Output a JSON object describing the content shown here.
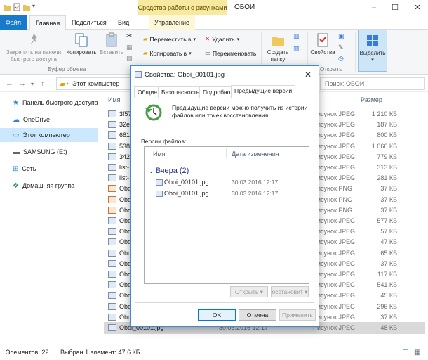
{
  "window": {
    "title": "ОБОИ",
    "context_tab": "Средства работы с рисунками"
  },
  "ribbon_tabs": [
    "Файл",
    "Главная",
    "Поделиться",
    "Вид",
    "Управление"
  ],
  "ribbon": {
    "pin_label": "Закрепить на панели быстрого доступа",
    "copy_label": "Копировать",
    "paste_label": "Вставить",
    "clipboard_group": "Буфер обмена",
    "move_to": "Переместить в",
    "copy_to": "Копировать в",
    "delete": "Удалить",
    "rename": "Переименовать",
    "new_folder": "Создать папку",
    "properties": "Свойства",
    "select": "Выделить",
    "open_group": "Открыть"
  },
  "address": {
    "crumb": "Этот компьютер",
    "search_placeholder": "Поиск: ОБОИ"
  },
  "sidebar": [
    {
      "label": "Панель быстрого доступа",
      "icon": "star-icon"
    },
    {
      "label": "OneDrive",
      "icon": "cloud-icon"
    },
    {
      "label": "Этот компьютер",
      "icon": "computer-icon",
      "selected": true
    },
    {
      "label": "SAMSUNG (E:)",
      "icon": "drive-icon"
    },
    {
      "label": "Сеть",
      "icon": "network-icon"
    },
    {
      "label": "Домашняя группа",
      "icon": "homegroup-icon"
    }
  ],
  "columns": {
    "name": "Имя",
    "size": "Размер"
  },
  "files": [
    {
      "name": "3f57",
      "type": "Рисунок JPEG",
      "size": "1 210 КБ",
      "png": false
    },
    {
      "name": "32ea",
      "type": "Рисунок JPEG",
      "size": "187 КБ",
      "png": false
    },
    {
      "name": "6814",
      "type": "Рисунок JPEG",
      "size": "800 КБ",
      "png": false
    },
    {
      "name": "5384",
      "type": "Рисунок JPEG",
      "size": "1 066 КБ",
      "png": false
    },
    {
      "name": "3429",
      "type": "Рисунок JPEG",
      "size": "779 КБ",
      "png": false
    },
    {
      "name": "list-",
      "type": "Рисунок JPEG",
      "size": "313 КБ",
      "png": false
    },
    {
      "name": "list-",
      "type": "Рисунок JPEG",
      "size": "281 КБ",
      "png": false
    },
    {
      "name": "Oboi",
      "type": "Рисунок PNG",
      "size": "37 КБ",
      "png": true
    },
    {
      "name": "Oboi",
      "type": "Рисунок PNG",
      "size": "37 КБ",
      "png": true
    },
    {
      "name": "Oboi",
      "type": "Рисунок PNG",
      "size": "37 КБ",
      "png": true
    },
    {
      "name": "Oboi",
      "type": "Рисунок JPEG",
      "size": "577 КБ",
      "png": false
    },
    {
      "name": "Oboi",
      "type": "Рисунок JPEG",
      "size": "57 КБ",
      "png": false
    },
    {
      "name": "Oboi",
      "type": "Рисунок JPEG",
      "size": "47 КБ",
      "png": false
    },
    {
      "name": "Oboi",
      "type": "Рисунок JPEG",
      "size": "65 КБ",
      "png": false
    },
    {
      "name": "Oboi",
      "type": "Рисунок JPEG",
      "size": "37 КБ",
      "png": false
    },
    {
      "name": "Oboi",
      "type": "Рисунок JPEG",
      "size": "117 КБ",
      "png": false
    },
    {
      "name": "Oboi",
      "type": "Рисунок JPEG",
      "size": "541 КБ",
      "png": false
    },
    {
      "name": "Oboi",
      "type": "Рисунок JPEG",
      "size": "45 КБ",
      "png": false
    },
    {
      "name": "Oboi",
      "type": "Рисунок JPEG",
      "size": "296 КБ",
      "png": false
    },
    {
      "name": "Oboi_00070.jpg",
      "date": "30.03.2016 12:23",
      "type": "Рисунок JPEG",
      "size": "37 КБ",
      "png": false
    },
    {
      "name": "Oboi_00101.jpg",
      "date": "30.03.2016 12:17",
      "type": "Рисунок JPEG",
      "size": "48 КБ",
      "png": false,
      "selected": true
    }
  ],
  "status": {
    "count": "Элементов: 22",
    "selected": "Выбран 1 элемент: 47,6 КБ"
  },
  "dialog": {
    "title": "Свойства: Oboi_00101.jpg",
    "tabs": [
      "Общие",
      "Безопасность",
      "Подробно",
      "Предыдущие версии"
    ],
    "description": "Предыдущие версии можно получить из истории файлов или точек восстановления.",
    "versions_label": "Версии файлов:",
    "col_name": "Имя",
    "col_date": "Дата изменения",
    "group": "Вчера (2)",
    "versions": [
      {
        "name": "Oboi_00101.jpg",
        "date": "30.03.2016 12:17"
      },
      {
        "name": "Oboi_00101.jpg",
        "date": "30.03.2016 12:17"
      }
    ],
    "open_button": "Открыть",
    "restore_button": "осстановит",
    "ok_button": "OK",
    "cancel_button": "Отмена",
    "apply_button": "Применить"
  }
}
